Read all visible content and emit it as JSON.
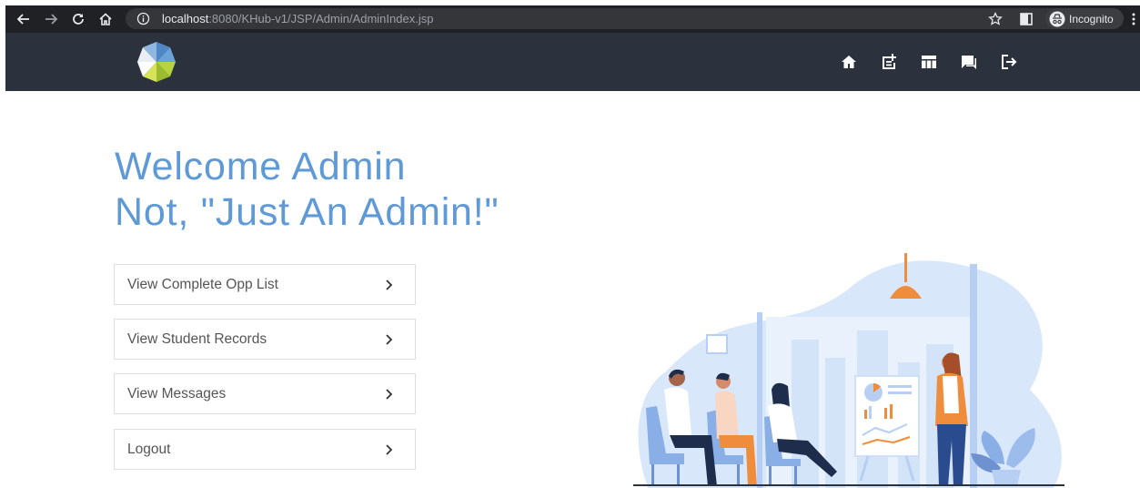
{
  "browser": {
    "url_host": "localhost",
    "url_path": ":8080/KHub-v1/JSP/Admin/AdminIndex.jsp",
    "incognito_label": "Incognito"
  },
  "navbar": {
    "icons": [
      "home-icon",
      "add-post-icon",
      "table-icon",
      "messages-icon",
      "logout-icon"
    ]
  },
  "welcome": {
    "line1": "Welcome Admin",
    "line2": "Not, \"Just An Admin!\""
  },
  "menu": {
    "items": [
      {
        "label": "View Complete Opp List"
      },
      {
        "label": "View Student Records"
      },
      {
        "label": "View Messages"
      },
      {
        "label": "Logout"
      }
    ]
  },
  "colors": {
    "navbar": "#2c323d",
    "accent": "#5f9ad6",
    "browser_chrome": "#202124"
  }
}
